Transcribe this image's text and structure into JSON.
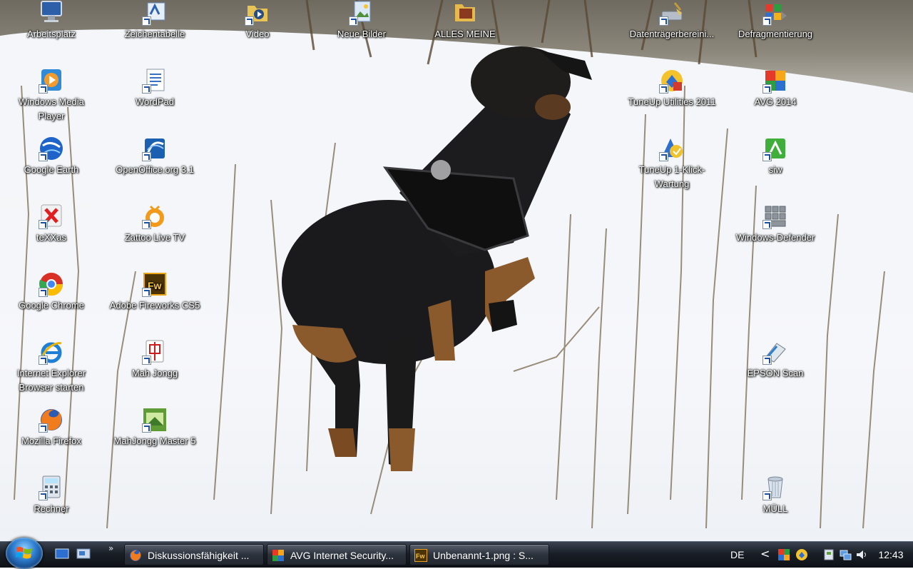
{
  "desktop": {
    "icons": [
      {
        "label": "Arbeitsplatz",
        "icon": "computer-icon"
      },
      {
        "label": "Zeichentabelle",
        "icon": "character-map-icon"
      },
      {
        "label": "Video",
        "icon": "video-folder-icon"
      },
      {
        "label": "Neue Bilder",
        "icon": "pictures-folder-icon"
      },
      {
        "label": "ALLES MEINE",
        "icon": "folder-icon"
      },
      {
        "label": "Datenträgerbereini...",
        "icon": "disk-cleanup-icon"
      },
      {
        "label": "Defragmentierung",
        "icon": "defrag-icon"
      },
      {
        "label": "Windows Media Player",
        "icon": "media-player-icon"
      },
      {
        "label": "WordPad",
        "icon": "wordpad-icon"
      },
      {
        "label": "TuneUp Utilities 2011",
        "icon": "tuneup-icon"
      },
      {
        "label": "AVG 2014",
        "icon": "avg-icon"
      },
      {
        "label": "Google Earth",
        "icon": "google-earth-icon"
      },
      {
        "label": "OpenOffice.org 3.1",
        "icon": "openoffice-icon"
      },
      {
        "label": "TuneUp 1-Klick-Wartung",
        "icon": "tuneup-oneclick-icon"
      },
      {
        "label": "siw",
        "icon": "siw-icon"
      },
      {
        "label": "teXXas",
        "icon": "texxas-icon"
      },
      {
        "label": "Zattoo Live TV",
        "icon": "zattoo-icon"
      },
      {
        "label": "Windows-Defender",
        "icon": "defender-icon"
      },
      {
        "label": "Google Chrome",
        "icon": "chrome-icon"
      },
      {
        "label": "Adobe Fireworks CS5",
        "icon": "fireworks-icon"
      },
      {
        "label": "Internet Explorer Browser starten",
        "icon": "internet-explorer-icon"
      },
      {
        "label": "Mah Jongg",
        "icon": "mahjongg-icon"
      },
      {
        "label": "EPSON Scan",
        "icon": "epson-scan-icon"
      },
      {
        "label": "Mozilla Firefox",
        "icon": "firefox-icon"
      },
      {
        "label": "MahJongg Master 5",
        "icon": "mahjongg-master-icon"
      },
      {
        "label": "Rechner",
        "icon": "calculator-icon"
      },
      {
        "label": "MÜLL",
        "icon": "recycle-bin-icon"
      }
    ]
  },
  "taskbar": {
    "start_icon": "windows-logo-icon",
    "quick_launch": [
      {
        "icon": "show-desktop-icon"
      },
      {
        "icon": "switch-windows-icon"
      }
    ],
    "quick_launch_more": "»",
    "tasks": [
      {
        "label": "Diskussionsfähigkeit ...",
        "icon": "firefox-icon"
      },
      {
        "label": "AVG Internet Security...",
        "icon": "avg-icon"
      },
      {
        "label": "Unbenannt-1.png : S...",
        "icon": "fireworks-icon"
      }
    ],
    "language": "DE",
    "tray_chevron": "<",
    "tray_icons": [
      "tuneup-tray-icon",
      "avg-tray-icon",
      "usb-device-icon",
      "network-icon",
      "volume-icon"
    ],
    "clock": "12:43"
  }
}
